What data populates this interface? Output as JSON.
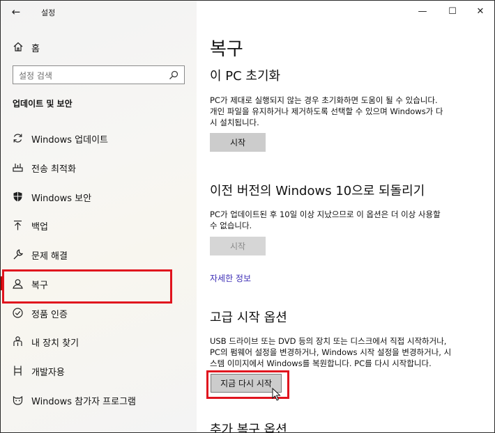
{
  "window": {
    "title": "설정",
    "back_glyph": "←",
    "minimize_glyph": "—",
    "maximize_glyph": "☐",
    "close_glyph": "✕"
  },
  "sidebar": {
    "home_label": "홈",
    "search_placeholder": "설정 검색",
    "section_title": "업데이트 및 보안",
    "items": [
      {
        "label": "Windows 업데이트",
        "icon": "sync-icon"
      },
      {
        "label": "전송 최적화",
        "icon": "delivery-optimization-icon"
      },
      {
        "label": "Windows 보안",
        "icon": "shield-icon"
      },
      {
        "label": "백업",
        "icon": "backup-arrow-icon"
      },
      {
        "label": "문제 해결",
        "icon": "wrench-icon"
      },
      {
        "label": "복구",
        "icon": "recovery-icon",
        "selected": true
      },
      {
        "label": "정품 인증",
        "icon": "check-circle-icon"
      },
      {
        "label": "내 장치 찾기",
        "icon": "person-pin-icon"
      },
      {
        "label": "개발자용",
        "icon": "developer-tools-icon"
      },
      {
        "label": "Windows 참가자 프로그램",
        "icon": "insider-cat-icon"
      }
    ]
  },
  "main": {
    "title": "복구",
    "reset": {
      "heading": "이 PC 초기화",
      "description_lines": [
        "PC가 제대로 실행되지 않는 경우 초기화하면 도움이 될 수 있습니다.",
        "개인 파일을 유지하거나 제거하도록 선택할 수 있으며 Windows가 다",
        "시 설치됩니다."
      ],
      "button": "시작"
    },
    "go_back": {
      "heading": "이전 버전의 Windows 10으로 되돌리기",
      "description_lines": [
        "PC가 업데이트된 후 10일 이상 지났으므로 이 옵션은 더 이상 사용할",
        "수 없습니다."
      ],
      "button": "시작"
    },
    "learn_more": "자세한 정보",
    "advanced": {
      "heading": "고급 시작 옵션",
      "description_lines": [
        "USB 드라이브 또는 DVD 등의 장치 또는 디스크에서 직접 시작하거나,",
        "PC의 펌웨어 설정을 변경하거나, Windows 시작 설정을 변경하거나, 시",
        "스템 이미지에서 Windows를 복원합니다. PC를 다시 시작합니다."
      ],
      "button": "지금 다시 시작"
    },
    "more_heading": "추가 복구 옵션"
  },
  "colors": {
    "highlight_red": "#e0141e",
    "link": "#3c2db5",
    "button_bg": "#cccccc"
  }
}
